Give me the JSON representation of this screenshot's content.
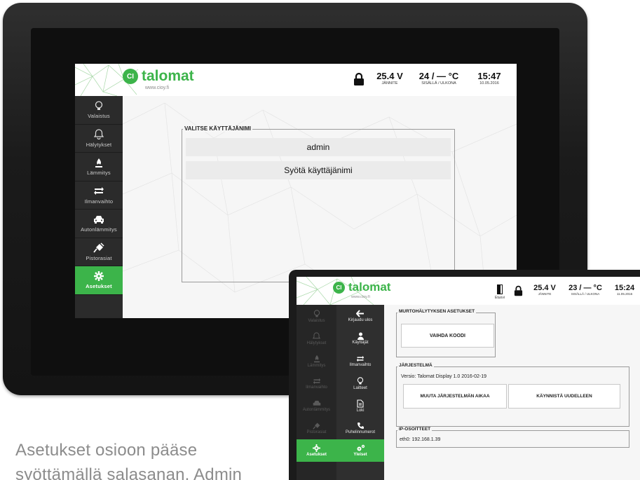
{
  "device": {
    "logo_ci": "CI",
    "logo_name": "talomat",
    "logo_url": "www.cioy.fi",
    "header": {
      "voltage": "25.4 V",
      "voltage_label": "JÄNNITE",
      "temperature": "24 / — °C",
      "temperature_label": "SISÄLLÄ / ULKONA",
      "time": "15:47",
      "date": "10.05.2016"
    },
    "sidebar": [
      {
        "label": "Valaistus",
        "icon": "bulb-icon"
      },
      {
        "label": "Hälytykset",
        "icon": "bell-icon"
      },
      {
        "label": "Lämmitys",
        "icon": "flame-icon"
      },
      {
        "label": "Ilmanvaihto",
        "icon": "cycle-icon"
      },
      {
        "label": "Autonlämmitys",
        "icon": "car-icon"
      },
      {
        "label": "Pistorasiat",
        "icon": "plug-icon"
      },
      {
        "label": "Asetukset",
        "icon": "gear-icon"
      }
    ],
    "active_item": "Asetukset",
    "login": {
      "legend": "VALITSE KÄYTTÄJÄNIMI",
      "user": "admin",
      "enter_username": "Syötä käyttäjänimi"
    }
  },
  "tablet": {
    "logo_ci": "CI",
    "logo_name": "talomat",
    "logo_url": "www.cioy.fi",
    "header": {
      "door_label": "Etuovi",
      "voltage": "25.4 V",
      "voltage_label": "JÄNNITE",
      "temperature": "23 / — °C",
      "temperature_label": "SISÄLLÄ / ULKONA",
      "time": "15:24",
      "date": "11.05.2016"
    },
    "sidebar_main": [
      {
        "label": "Valaistus",
        "icon": "bulb-icon"
      },
      {
        "label": "Hälytykset",
        "icon": "bell-icon"
      },
      {
        "label": "Lämmitys",
        "icon": "flame-icon"
      },
      {
        "label": "Ilmanvaihto",
        "icon": "cycle-icon"
      },
      {
        "label": "Autonlämmitys",
        "icon": "car-icon"
      },
      {
        "label": "Pistorasiat",
        "icon": "plug-icon"
      },
      {
        "label": "Asetukset",
        "icon": "gear-icon"
      }
    ],
    "sidebar_sub": [
      {
        "label": "Kirjaudu ulos",
        "icon": "arrow-left-icon"
      },
      {
        "label": "Käyttäjät",
        "icon": "user-icon"
      },
      {
        "label": "Ilmanvaihto",
        "icon": "cycle-icon"
      },
      {
        "label": "Laitteet",
        "icon": "bulb-icon"
      },
      {
        "label": "Loki",
        "icon": "document-icon"
      },
      {
        "label": "Puhelinnumerot",
        "icon": "phone-icon"
      },
      {
        "label": "Yleiset",
        "icon": "gears-icon"
      }
    ],
    "alarm": {
      "legend": "MURTOHÄLYTYKSEN ASETUKSET",
      "change_code": "VAIHDA KOODI"
    },
    "system": {
      "legend": "JÄRJESTELMÄ",
      "version": "Versio: Talomat Display 1.0 2016-02-19",
      "change_time": "MUUTA JÄRJESTELMÄN AIKAA",
      "restart": "KÄYNNISTÄ UUDELLEEN"
    },
    "ip": {
      "legend": "IP-OSOITTEET",
      "eth0": "eth0: 192.168.1.39"
    }
  },
  "caption": {
    "line1": "Asetukset osioon pääse",
    "line2": "syöttämällä salasanan. Admin"
  },
  "colors": {
    "accent": "#3cb44a",
    "sidebar": "#2b2b2b",
    "bezel": "#1b1b1b"
  }
}
